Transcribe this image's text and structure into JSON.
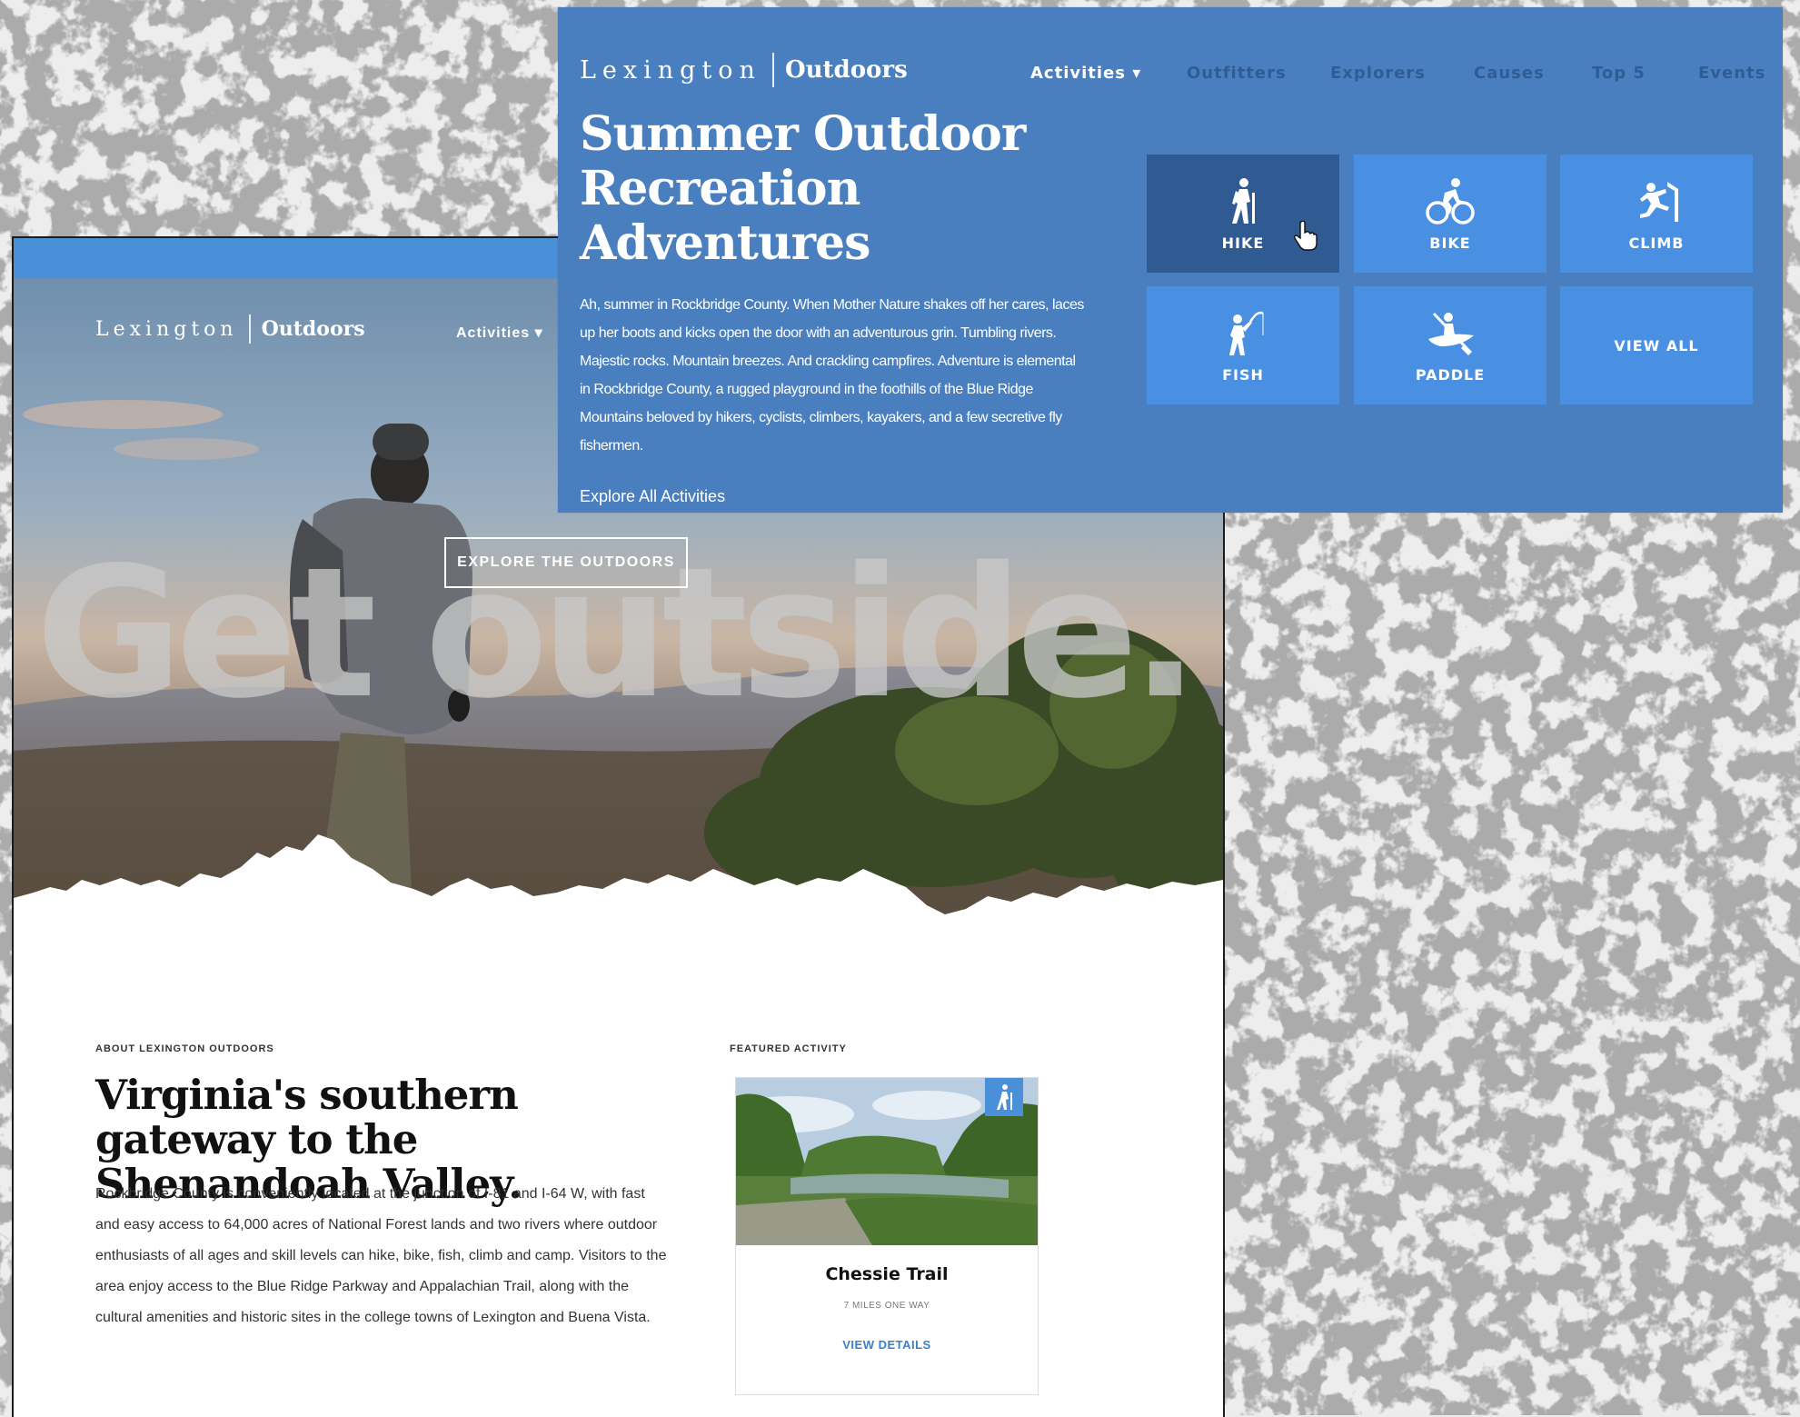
{
  "hero": {
    "brand_light": "Lexington",
    "brand_bold": "Outdoors",
    "nav_activities": "Activities ▾",
    "cta": "EXPLORE THE OUTDOORS",
    "headline": "Get outside."
  },
  "about": {
    "eyebrow": "ABOUT LEXINGTON OUTDOORS",
    "heading": "Virginia's southern gateway to the Shenandoah Valley.",
    "body": "Rockbridge County is conveniently located at the junction of I-81 and I-64 W, with fast and easy access to 64,000 acres of National Forest lands and two rivers where outdoor enthusiasts of all ages and skill levels can hike, bike, fish, climb and camp. Visitors to the area enjoy access to the Blue Ridge Parkway and Appalachian Trail, along with the cultural amenities and historic sites in the college towns of Lexington and Buena Vista."
  },
  "featured": {
    "eyebrow": "FEATURED ACTIVITY",
    "title": "Chessie Trail",
    "meta": "7 MILES ONE WAY",
    "link": "VIEW DETAILS",
    "badge_icon": "hiker-icon"
  },
  "menu": {
    "brand_light": "Lexington",
    "brand_bold": "Outdoors",
    "nav": {
      "activities": "Activities ▾",
      "outfitters": "Outfitters",
      "explorers": "Explorers",
      "causes": "Causes",
      "top5": "Top 5",
      "events": "Events"
    },
    "title": "Summer Outdoor Recreation Adventures",
    "description": "Ah, summer in Rockbridge County. When Mother Nature shakes off her cares, laces up her boots and kicks open the door with an adventurous grin. Tumbling rivers. Majestic rocks. Mountain breezes. And crackling campfires. Adventure is elemental in Rockbridge County, a rugged playground in the foothills of the Blue Ridge Mountains beloved by hikers, cyclists, climbers, kayakers, and a few secretive fly fishermen.",
    "explore_link": "Explore All Activities",
    "tiles": {
      "hike": "HIKE",
      "bike": "BIKE",
      "climb": "CLIMB",
      "fish": "FISH",
      "paddle": "PADDLE",
      "view_all": "VIEW ALL"
    },
    "hovered_tile": "HIKE"
  },
  "colors": {
    "menu_bg": "#4a7fbf",
    "tile_bg": "#4a90e2",
    "tile_hover": "#2f5b92",
    "nav_inactive": "#2d5d94",
    "link_blue": "#3d7fc7",
    "topbar": "#4a90d9"
  }
}
